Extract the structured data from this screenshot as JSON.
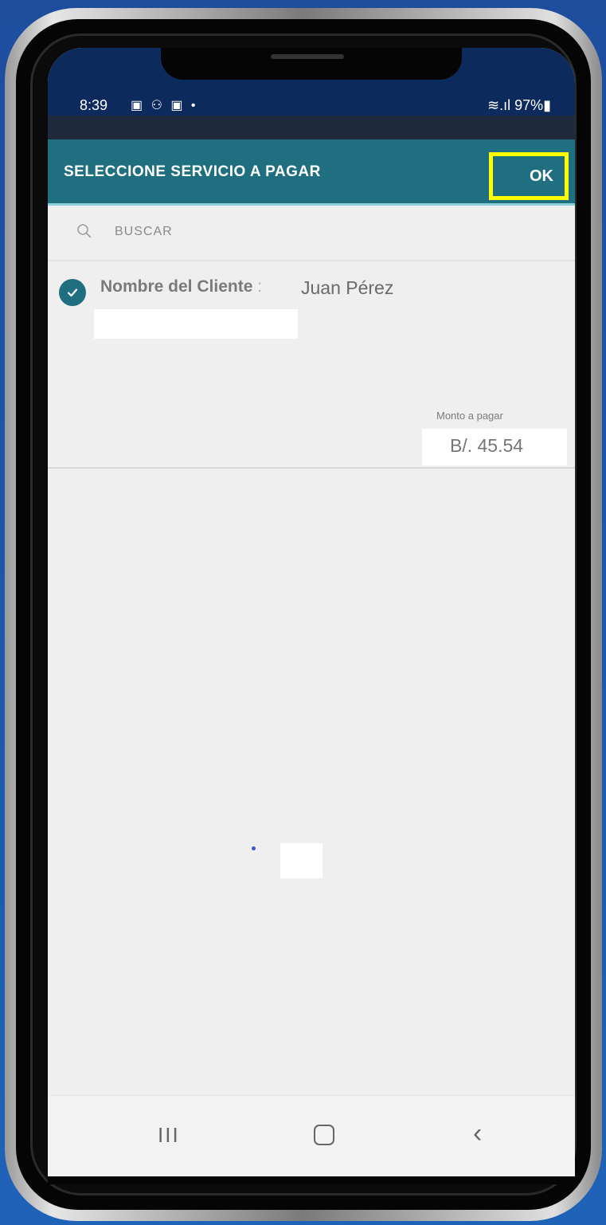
{
  "status_bar": {
    "time": "8:39",
    "notification_icons": [
      "gallery-icon",
      "teams-icon",
      "calendar-icon"
    ],
    "notification_glyphs": "▣ ⚇ ▣ •",
    "right_indicators": "≋.ıl 97%▮"
  },
  "app_bar": {
    "title": "SELECCIONE SERVICIO A PAGAR",
    "ok_label": "OK",
    "highlight_color": "#ffff00",
    "color": "#1f6f80"
  },
  "search": {
    "placeholder": "BUSCAR"
  },
  "services": [
    {
      "checked": true,
      "client_label": "Nombre del Cliente",
      "separator": ":",
      "client_name": "Juan Pérez",
      "amount_label": "Monto a pagar",
      "amount": "B/. 45.54"
    }
  ],
  "nav_bar": {
    "recents": "III",
    "back": "‹"
  }
}
